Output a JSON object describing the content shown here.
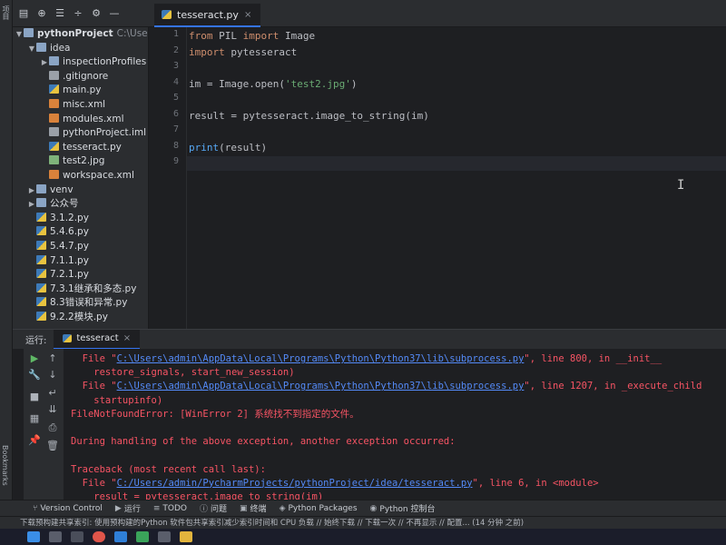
{
  "left_strip": {
    "project_label": "项目",
    "bookmarks_label": "Bookmarks"
  },
  "project_toolbar": {
    "icons": [
      "project-view-icon",
      "locate-icon",
      "expand-all-icon",
      "collapse-all-icon",
      "gear-icon",
      "minimize-icon"
    ]
  },
  "tree": {
    "root": {
      "name": "pythonProject",
      "path": "C:\\Users\\a"
    },
    "items": [
      {
        "label": "idea",
        "depth": 1,
        "expanded": true,
        "type": "folder"
      },
      {
        "label": "inspectionProfiles",
        "depth": 2,
        "expanded": false,
        "type": "folder"
      },
      {
        "label": ".gitignore",
        "depth": 2,
        "type": "txt"
      },
      {
        "label": "main.py",
        "depth": 2,
        "type": "py"
      },
      {
        "label": "misc.xml",
        "depth": 2,
        "type": "xml"
      },
      {
        "label": "modules.xml",
        "depth": 2,
        "type": "xml"
      },
      {
        "label": "pythonProject.iml",
        "depth": 2,
        "type": "txt"
      },
      {
        "label": "tesseract.py",
        "depth": 2,
        "type": "py"
      },
      {
        "label": "test2.jpg",
        "depth": 2,
        "type": "img"
      },
      {
        "label": "workspace.xml",
        "depth": 2,
        "type": "xml"
      },
      {
        "label": "venv",
        "depth": 1,
        "expanded": false,
        "type": "folder"
      },
      {
        "label": "公众号",
        "depth": 1,
        "expanded": false,
        "type": "folder"
      },
      {
        "label": "3.1.2.py",
        "depth": 1,
        "type": "py"
      },
      {
        "label": "5.4.6.py",
        "depth": 1,
        "type": "py"
      },
      {
        "label": "5.4.7.py",
        "depth": 1,
        "type": "py"
      },
      {
        "label": "7.1.1.py",
        "depth": 1,
        "type": "py"
      },
      {
        "label": "7.2.1.py",
        "depth": 1,
        "type": "py"
      },
      {
        "label": "7.3.1继承和多态.py",
        "depth": 1,
        "type": "py"
      },
      {
        "label": "8.3错误和异常.py",
        "depth": 1,
        "type": "py"
      },
      {
        "label": "9.2.2模块.py",
        "depth": 1,
        "type": "py"
      }
    ]
  },
  "editor": {
    "tab": {
      "label": "tesseract.py",
      "close": "×"
    },
    "line_numbers": [
      "1",
      "2",
      "3",
      "4",
      "5",
      "6",
      "7",
      "8",
      "9"
    ],
    "lines": [
      [
        {
          "t": "from ",
          "c": "kw"
        },
        {
          "t": "PIL ",
          "c": ""
        },
        {
          "t": "import ",
          "c": "kw"
        },
        {
          "t": "Image",
          "c": ""
        }
      ],
      [
        {
          "t": "import ",
          "c": "kw"
        },
        {
          "t": "pytesseract",
          "c": ""
        }
      ],
      [],
      [
        {
          "t": "im = Image.open(",
          "c": ""
        },
        {
          "t": "'test2.jpg'",
          "c": "str"
        },
        {
          "t": ")",
          "c": ""
        }
      ],
      [],
      [
        {
          "t": "result = pytesseract.image_to_string(im)",
          "c": ""
        }
      ],
      [],
      [
        {
          "t": "print",
          "c": "fn"
        },
        {
          "t": "(result)",
          "c": ""
        }
      ],
      []
    ],
    "current_line": 9
  },
  "run": {
    "label": "运行:",
    "tab_label": "tesseract",
    "tab_close": "×",
    "output": [
      [
        {
          "t": "  File \"",
          "l": false
        },
        {
          "t": "C:\\Users\\admin\\AppData\\Local\\Programs\\Python\\Python37\\lib\\subprocess.py",
          "l": true
        },
        {
          "t": "\", line 800, in __init__",
          "l": false
        }
      ],
      [
        {
          "t": "    restore_signals, start_new_session)",
          "l": false
        }
      ],
      [
        {
          "t": "  File \"",
          "l": false
        },
        {
          "t": "C:\\Users\\admin\\AppData\\Local\\Programs\\Python\\Python37\\lib\\subprocess.py",
          "l": true
        },
        {
          "t": "\", line 1207, in _execute_child",
          "l": false
        }
      ],
      [
        {
          "t": "    startupinfo)",
          "l": false
        }
      ],
      [
        {
          "t": "FileNotFoundError: [WinError 2] 系统找不到指定的文件。",
          "l": false
        }
      ],
      [],
      [
        {
          "t": "During handling of the above exception, another exception occurred:",
          "l": false
        }
      ],
      [],
      [
        {
          "t": "Traceback (most recent call last):",
          "l": false
        }
      ],
      [
        {
          "t": "  File \"",
          "l": false
        },
        {
          "t": "C:/Users/admin/PycharmProjects/pythonProject/idea/tesseract.py",
          "l": true
        },
        {
          "t": "\", line 6, in <module>",
          "l": false
        }
      ],
      [
        {
          "t": "    result = pytesseract.image_to_string(im)",
          "l": false
        }
      ]
    ]
  },
  "bottom_bar": {
    "items": [
      {
        "label": "Version Control",
        "icon": "vcs-icon",
        "glyph": "⑂"
      },
      {
        "label": "运行",
        "icon": "run-icon",
        "glyph": "▶"
      },
      {
        "label": "TODO",
        "icon": "todo-icon",
        "glyph": "≡"
      },
      {
        "label": "问题",
        "icon": "problems-icon",
        "glyph": "ⓘ"
      },
      {
        "label": "终端",
        "icon": "terminal-icon",
        "glyph": "▣"
      },
      {
        "label": "Python Packages",
        "icon": "packages-icon",
        "glyph": "◈"
      },
      {
        "label": "Python 控制台",
        "icon": "python-console-icon",
        "glyph": "◉"
      }
    ]
  },
  "status": {
    "text": "下载预构建共享索引: 使用预构建的Python 软件包共享索引减少索引时间和 CPU 负载 // 始终下载 // 下载一次 // 不再显示 // 配置... (14 分钟 之前)"
  },
  "colors": {
    "accent": "#3574f0",
    "error": "#f75464",
    "link": "#548af7",
    "keyword": "#cf8e6d",
    "string": "#6aab73"
  }
}
